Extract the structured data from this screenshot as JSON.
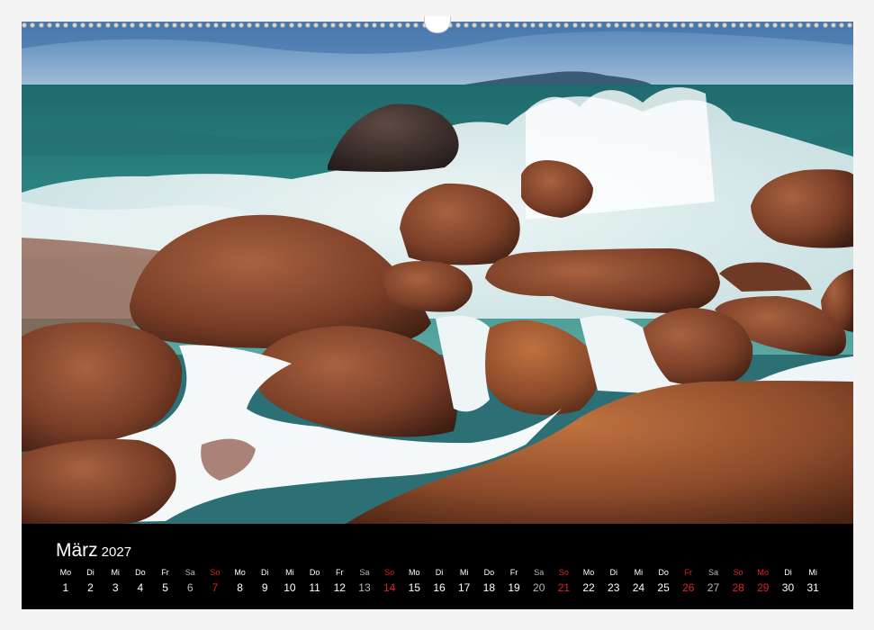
{
  "calendar": {
    "month": "März",
    "year": "2027",
    "days": [
      {
        "weekday": "Mo",
        "day": "1",
        "type": "weekday"
      },
      {
        "weekday": "Di",
        "day": "2",
        "type": "weekday"
      },
      {
        "weekday": "Mi",
        "day": "3",
        "type": "weekday"
      },
      {
        "weekday": "Do",
        "day": "4",
        "type": "weekday"
      },
      {
        "weekday": "Fr",
        "day": "5",
        "type": "weekday"
      },
      {
        "weekday": "Sa",
        "day": "6",
        "type": "saturday"
      },
      {
        "weekday": "So",
        "day": "7",
        "type": "sunday"
      },
      {
        "weekday": "Mo",
        "day": "8",
        "type": "weekday"
      },
      {
        "weekday": "Di",
        "day": "9",
        "type": "weekday"
      },
      {
        "weekday": "Mi",
        "day": "10",
        "type": "weekday"
      },
      {
        "weekday": "Do",
        "day": "11",
        "type": "weekday"
      },
      {
        "weekday": "Fr",
        "day": "12",
        "type": "weekday"
      },
      {
        "weekday": "Sa",
        "day": "13",
        "type": "saturday"
      },
      {
        "weekday": "So",
        "day": "14",
        "type": "sunday"
      },
      {
        "weekday": "Mo",
        "day": "15",
        "type": "weekday"
      },
      {
        "weekday": "Di",
        "day": "16",
        "type": "weekday"
      },
      {
        "weekday": "Mi",
        "day": "17",
        "type": "weekday"
      },
      {
        "weekday": "Do",
        "day": "18",
        "type": "weekday"
      },
      {
        "weekday": "Fr",
        "day": "19",
        "type": "weekday"
      },
      {
        "weekday": "Sa",
        "day": "20",
        "type": "saturday"
      },
      {
        "weekday": "So",
        "day": "21",
        "type": "sunday"
      },
      {
        "weekday": "Mo",
        "day": "22",
        "type": "weekday"
      },
      {
        "weekday": "Di",
        "day": "23",
        "type": "weekday"
      },
      {
        "weekday": "Mi",
        "day": "24",
        "type": "weekday"
      },
      {
        "weekday": "Do",
        "day": "25",
        "type": "weekday"
      },
      {
        "weekday": "Fr",
        "day": "26",
        "type": "sunday"
      },
      {
        "weekday": "Sa",
        "day": "27",
        "type": "saturday"
      },
      {
        "weekday": "So",
        "day": "28",
        "type": "sunday"
      },
      {
        "weekday": "Mo",
        "day": "29",
        "type": "sunday"
      },
      {
        "weekday": "Di",
        "day": "30",
        "type": "weekday"
      },
      {
        "weekday": "Mi",
        "day": "31",
        "type": "weekday"
      }
    ]
  },
  "colors": {
    "calendar_background": "#000000",
    "holiday_red": "#e02020",
    "saturday_gray": "#b8b8b8",
    "sea": "#2a7f7c",
    "rock": "#8a4a32"
  }
}
